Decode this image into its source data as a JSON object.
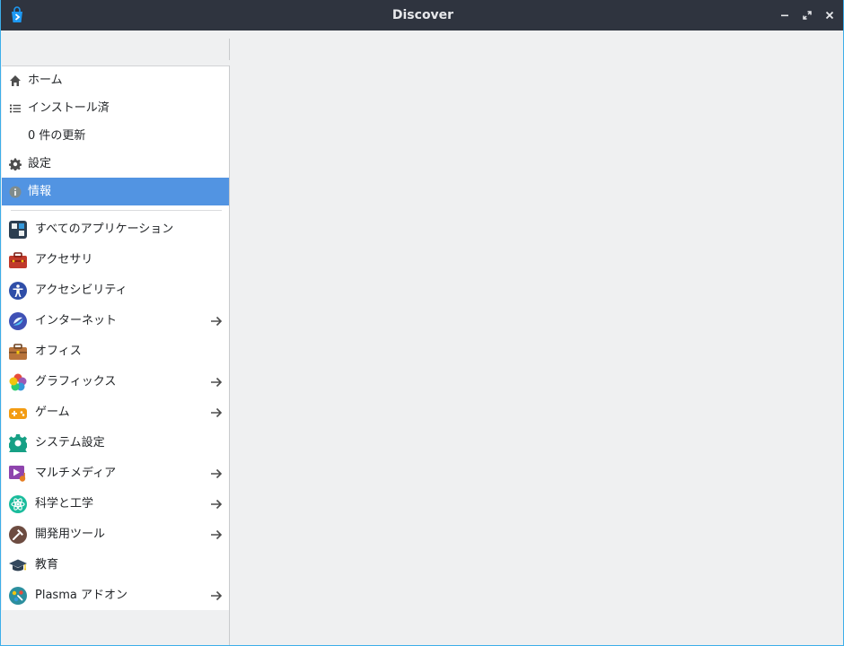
{
  "window": {
    "title": "Discover",
    "border_color": "#3daee9",
    "titlebar_color": "#2f343f"
  },
  "titlebar_buttons": [
    {
      "name": "minimize-icon"
    },
    {
      "name": "maximize-icon"
    },
    {
      "name": "close-icon"
    }
  ],
  "nav": {
    "items": [
      {
        "label": "ホーム",
        "icon": "home-icon"
      },
      {
        "label": "インストール済",
        "icon": "list-icon"
      },
      {
        "label": "0 件の更新",
        "icon": ""
      },
      {
        "label": "設定",
        "icon": "gear-icon"
      },
      {
        "label": "情報",
        "icon": "info-icon",
        "active": true
      }
    ]
  },
  "categories": {
    "items": [
      {
        "label": "すべてのアプリケーション",
        "icon": "all-applications-icon",
        "has_submenu": false
      },
      {
        "label": "アクセサリ",
        "icon": "accessories-icon",
        "has_submenu": false
      },
      {
        "label": "アクセシビリティ",
        "icon": "accessibility-icon",
        "has_submenu": false
      },
      {
        "label": "インターネット",
        "icon": "internet-icon",
        "has_submenu": true
      },
      {
        "label": "オフィス",
        "icon": "office-icon",
        "has_submenu": false
      },
      {
        "label": "グラフィックス",
        "icon": "graphics-icon",
        "has_submenu": true
      },
      {
        "label": "ゲーム",
        "icon": "games-icon",
        "has_submenu": true
      },
      {
        "label": "システム設定",
        "icon": "system-settings-icon",
        "has_submenu": false
      },
      {
        "label": "マルチメディア",
        "icon": "multimedia-icon",
        "has_submenu": true
      },
      {
        "label": "科学と工学",
        "icon": "science-icon",
        "has_submenu": true
      },
      {
        "label": "開発用ツール",
        "icon": "development-icon",
        "has_submenu": true
      },
      {
        "label": "教育",
        "icon": "education-icon",
        "has_submenu": false
      },
      {
        "label": "Plasma アドオン",
        "icon": "plasma-addons-icon",
        "has_submenu": true
      }
    ]
  },
  "colors": {
    "accent": "#5294e2",
    "sidebar_bg": "#ffffff",
    "window_bg": "#eff0f1"
  }
}
